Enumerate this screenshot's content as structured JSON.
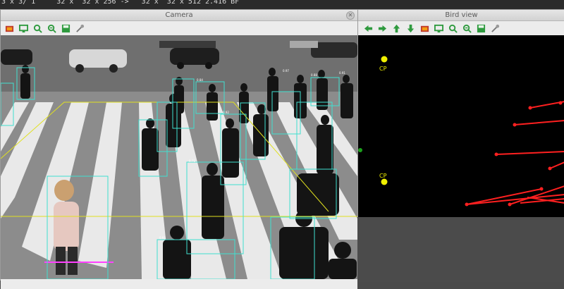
{
  "terminal": {
    "line": "3 x 3/ 1     32 x  32 x 256 ->   32 x  32 x 512 2.416 BF"
  },
  "camera_window": {
    "title": "Camera",
    "close_icon": "close-icon",
    "toolbar_icons": [
      "image-icon",
      "screenshot-icon",
      "zoom-in-icon",
      "zoom-out-icon",
      "save-icon",
      "properties-icon"
    ]
  },
  "bird_window": {
    "title": "Bird view",
    "toolbar_icons": [
      "arrow-left-icon",
      "arrow-right-icon",
      "arrow-up-icon",
      "arrow-down-icon",
      "image-icon",
      "screenshot-icon",
      "zoom-in-icon",
      "zoom-out-icon",
      "save-icon",
      "properties-icon"
    ],
    "cp_labels": [
      "CP",
      "CP"
    ]
  },
  "detections": [
    {
      "label": "0.84"
    },
    {
      "label": "0.97"
    },
    {
      "label": "0.71"
    },
    {
      "label": "0.93"
    },
    {
      "label": "0.88"
    },
    {
      "label": "0.91"
    },
    {
      "label": "0.92"
    }
  ],
  "colors": {
    "titlebar": "#dcdcdc",
    "toolbar_green": "#2e9a3e",
    "bbox": "#40e0d0",
    "region": "#e0e020",
    "bird_points": "#ff2020",
    "cp": "#f0f000"
  }
}
